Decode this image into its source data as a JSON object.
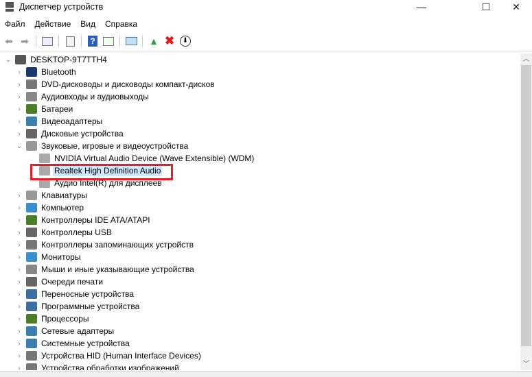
{
  "window": {
    "title": "Диспетчер устройств",
    "minimize": "—",
    "maximize": "☐",
    "close": "✕"
  },
  "menu": [
    "Файл",
    "Действие",
    "Вид",
    "Справка"
  ],
  "toolbar": [
    "back",
    "forward",
    "show-hide-console-tree",
    "properties",
    "help",
    "action-pane",
    "scan-hardware",
    "update-driver",
    "uninstall",
    "disable"
  ],
  "tree": {
    "root": "DESKTOP-9T7TTH4",
    "items": [
      {
        "label": "Bluetooth",
        "icon": "bluetooth",
        "color": "#1a3a6e"
      },
      {
        "label": "DVD-дисководы и дисководы компакт-дисков",
        "icon": "dvd",
        "color": "#777"
      },
      {
        "label": "Аудиовходы и аудиовыходы",
        "icon": "audio-io",
        "color": "#888"
      },
      {
        "label": "Батареи",
        "icon": "battery",
        "color": "#4a7d2a"
      },
      {
        "label": "Видеоадаптеры",
        "icon": "display-adapter",
        "color": "#3a7fb0"
      },
      {
        "label": "Дисковые устройства",
        "icon": "disk",
        "color": "#666"
      },
      {
        "label": "Звуковые, игровые и видеоустройства",
        "icon": "speaker",
        "color": "#999",
        "expanded": true,
        "children": [
          "NVIDIA Virtual Audio Device (Wave Extensible) (WDM)",
          "Realtek High Definition Audio",
          "Аудио Intel(R) для дисплеев"
        ]
      },
      {
        "label": "Клавиатуры",
        "icon": "keyboard",
        "color": "#999"
      },
      {
        "label": "Компьютер",
        "icon": "computer",
        "color": "#3a8fd0"
      },
      {
        "label": "Контроллеры IDE ATA/ATAPI",
        "icon": "ide",
        "color": "#4a7d2a"
      },
      {
        "label": "Контроллеры USB",
        "icon": "usb",
        "color": "#666"
      },
      {
        "label": "Контроллеры запоминающих устройств",
        "icon": "storage",
        "color": "#777"
      },
      {
        "label": "Мониторы",
        "icon": "monitor",
        "color": "#3a8fd0"
      },
      {
        "label": "Мыши и иные указывающие устройства",
        "icon": "mouse",
        "color": "#888"
      },
      {
        "label": "Очереди печати",
        "icon": "printer",
        "color": "#666"
      },
      {
        "label": "Переносные устройства",
        "icon": "portable",
        "color": "#3a6fa0"
      },
      {
        "label": "Программные устройства",
        "icon": "software",
        "color": "#3a6fa0"
      },
      {
        "label": "Процессоры",
        "icon": "cpu",
        "color": "#4a7d2a"
      },
      {
        "label": "Сетевые адаптеры",
        "icon": "network",
        "color": "#3a7fb0"
      },
      {
        "label": "Системные устройства",
        "icon": "system",
        "color": "#3a7fb0"
      },
      {
        "label": "Устройства HID (Human Interface Devices)",
        "icon": "hid",
        "color": "#777"
      },
      {
        "label": "Устройства обработки изображений",
        "icon": "imaging",
        "color": "#777"
      }
    ],
    "selected": "Realtek High Definition Audio"
  }
}
